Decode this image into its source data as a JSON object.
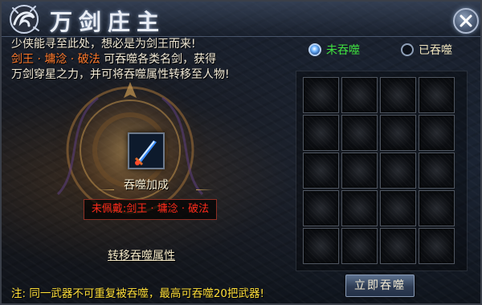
{
  "header": {
    "title": "万剑庄主"
  },
  "description": {
    "line1": "少侠能寻至此处，想必是为剑王而来!",
    "line2_highlight": "剑王 · 墉淰 · 破法",
    "line2_rest": "可吞噬各类名剑，获得",
    "line3": "万剑穿星之力，并可将吞噬属性转移至人物!"
  },
  "weapon": {
    "bonus_label": "吞噬加成",
    "status_text": "未佩戴:剑王 · 墉淰 · 破法"
  },
  "transfer_link": "转移吞噬属性",
  "note": "注: 同一武器不可重复被吞噬，最高可吞噬20把武器!",
  "filters": {
    "unswallowed": {
      "label": "未吞噬",
      "selected": true
    },
    "swallowed": {
      "label": "已吞噬",
      "selected": false
    }
  },
  "grid": {
    "rows": 5,
    "columns": 4
  },
  "swallow_button": "立即吞噬",
  "colors": {
    "highlight_orange": "#ff7a2c",
    "status_red": "#ff2a1a",
    "note_yellow": "#ffdf3a",
    "radio_green": "#3fe03f"
  }
}
